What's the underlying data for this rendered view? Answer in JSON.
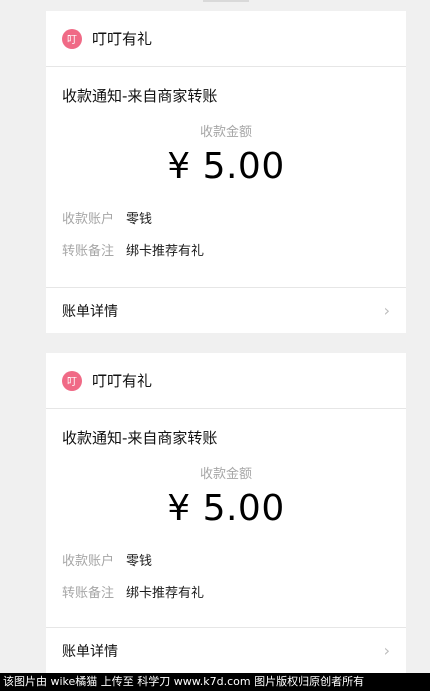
{
  "cards": [
    {
      "logo_text": "叮",
      "brand": "叮叮有礼",
      "title": "收款通知-来自商家转账",
      "amount_label": "收款金额",
      "amount": "¥ 5.00",
      "account_label": "收款账户",
      "account_value": "零钱",
      "remark_label": "转账备注",
      "remark_value": "绑卡推荐有礼",
      "footer_label": "账单详情",
      "chevron": "›"
    },
    {
      "logo_text": "叮",
      "brand": "叮叮有礼",
      "title": "收款通知-来自商家转账",
      "amount_label": "收款金额",
      "amount": "¥ 5.00",
      "account_label": "收款账户",
      "account_value": "零钱",
      "remark_label": "转账备注",
      "remark_value": "绑卡推荐有礼",
      "footer_label": "账单详情",
      "chevron": "›"
    }
  ],
  "watermark": "该图片由 wike橘猫 上传至 科学刀 www.k7d.com 图片版权归原创者所有",
  "colors": {
    "background": "#f0f0f0",
    "logo": "#f06a86",
    "muted_text": "#a6a6a6"
  },
  "icons": {
    "logo": "brand-logo-icon",
    "chevron": "chevron-right-icon"
  }
}
